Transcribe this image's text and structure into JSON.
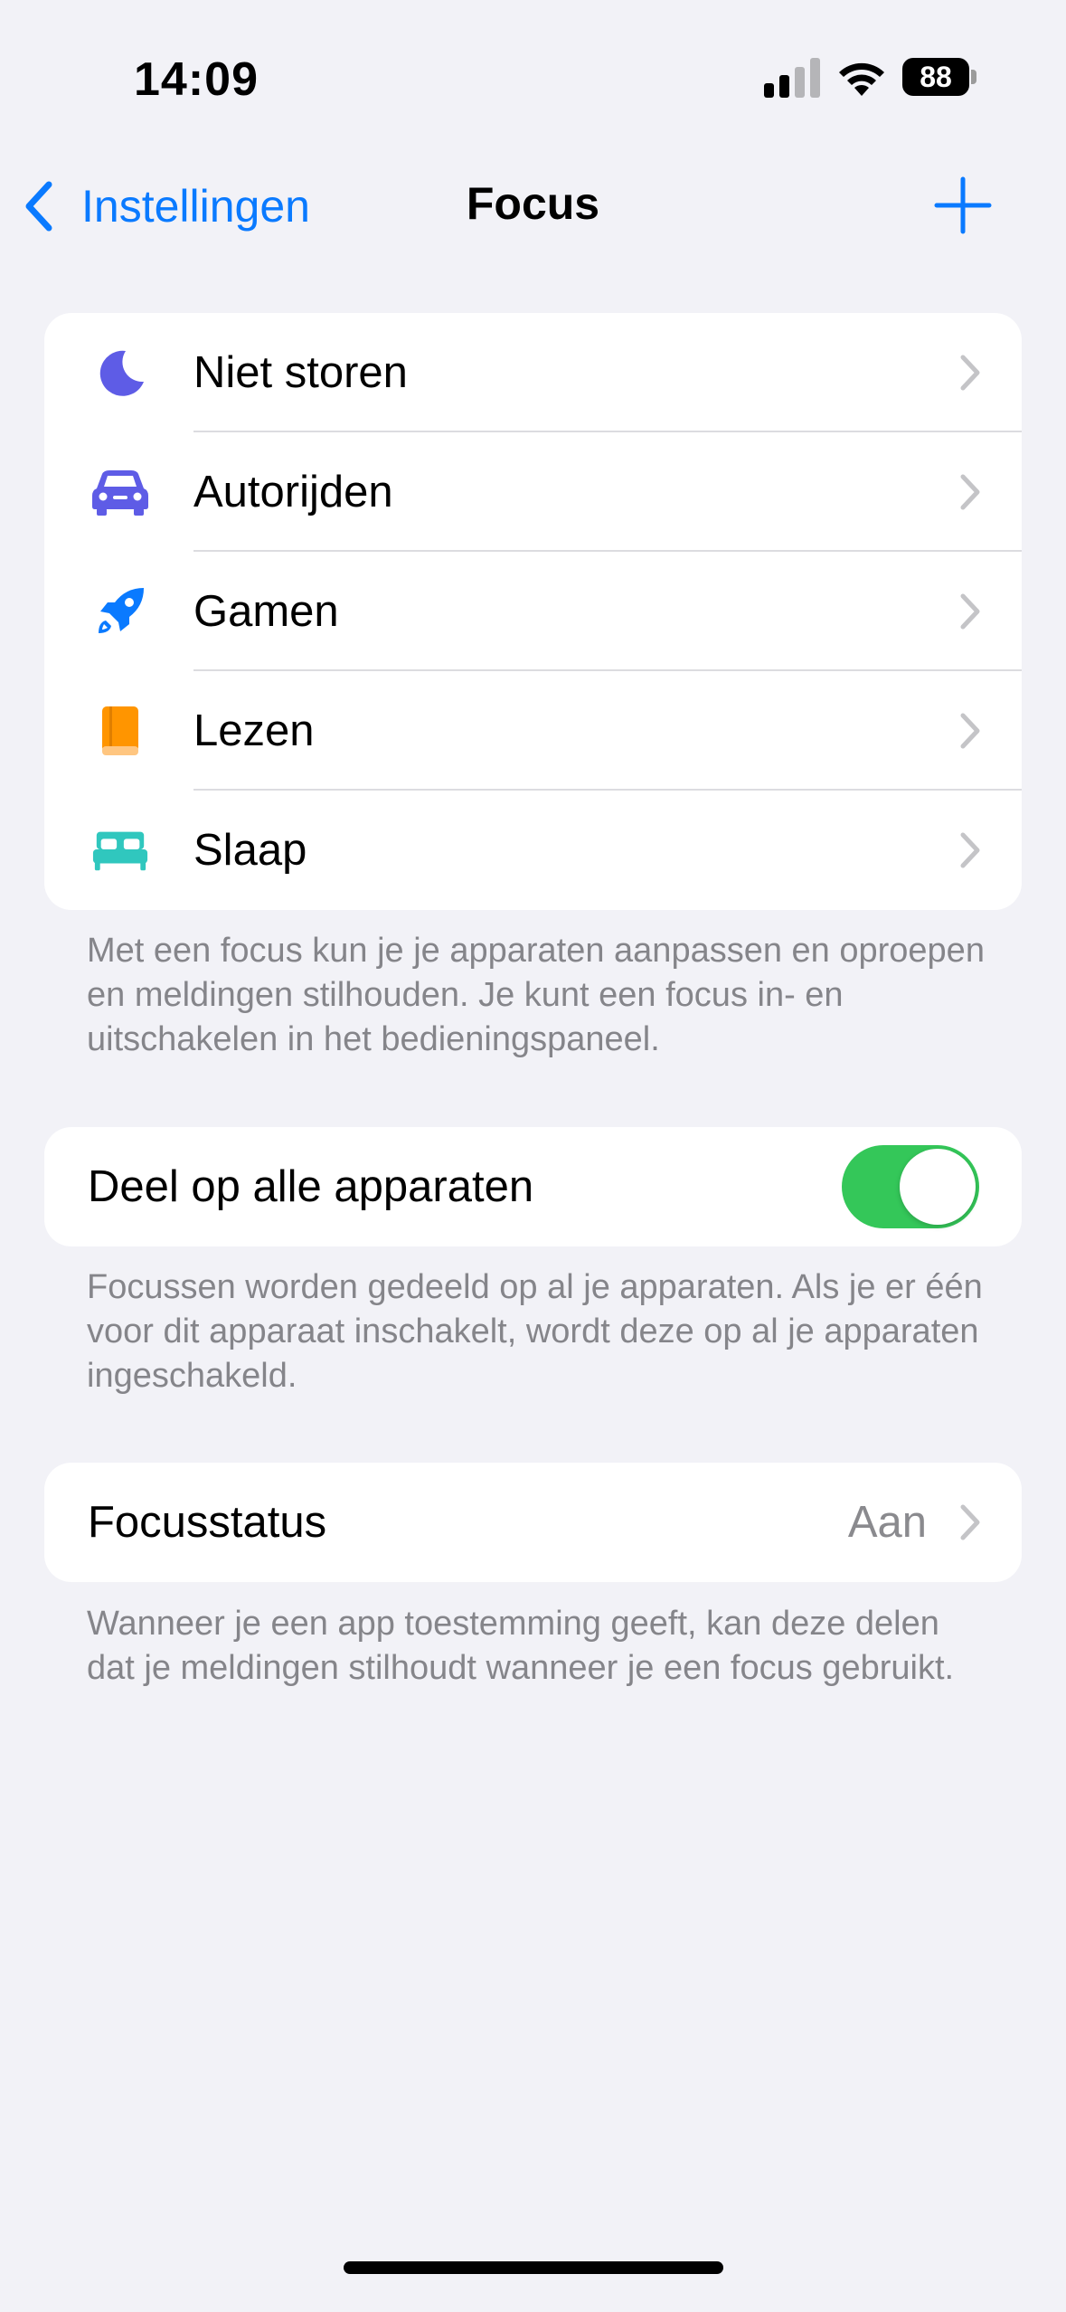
{
  "status_bar": {
    "time": "14:09",
    "battery_level": "88",
    "icons": [
      "signal-icon",
      "wifi-icon",
      "battery-icon"
    ]
  },
  "nav": {
    "back_label": "Instellingen",
    "title": "Focus",
    "add_icon": "plus-icon"
  },
  "focus_modes": [
    {
      "label": "Niet storen",
      "icon": "moon-icon",
      "color": "#5E5CE6"
    },
    {
      "label": "Autorijden",
      "icon": "car-icon",
      "color": "#5E5CE6"
    },
    {
      "label": "Gamen",
      "icon": "rocket-icon",
      "color": "#0A7AFF"
    },
    {
      "label": "Lezen",
      "icon": "book-icon",
      "color": "#FF9500"
    },
    {
      "label": "Slaap",
      "icon": "bed-icon",
      "color": "#30C7BE"
    }
  ],
  "focus_footnote": "Met een focus kun je je apparaten aanpassen en oproepen en meldingen stilhouden. Je kunt een focus in- en uitschakelen in het bedieningspaneel.",
  "share": {
    "label": "Deel op alle apparaten",
    "enabled": true,
    "toggle_color": "#34C759"
  },
  "share_footnote": "Focussen worden gedeeld op al je apparaten. Als je er één voor dit apparaat inschakelt, wordt deze op al je apparaten ingeschakeld.",
  "focus_status": {
    "label": "Focusstatus",
    "value": "Aan"
  },
  "status_footnote": "Wanneer je een app toestemming geeft, kan deze delen dat je meldingen stilhoudt wanneer je een focus gebruikt.",
  "accent_color": "#0A7AFF"
}
